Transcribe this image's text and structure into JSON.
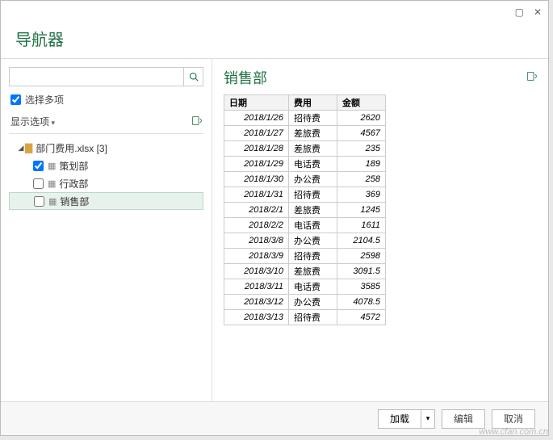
{
  "title": "导航器",
  "search": {
    "placeholder": ""
  },
  "selectMultiple": {
    "label": "选择多项",
    "checked": true
  },
  "displayOptions": {
    "label": "显示选项"
  },
  "tree": {
    "root": {
      "label": "部门费用.xlsx [3]"
    },
    "items": [
      {
        "label": "策划部",
        "checked": true,
        "selected": false
      },
      {
        "label": "行政部",
        "checked": false,
        "selected": false
      },
      {
        "label": "销售部",
        "checked": false,
        "selected": true
      }
    ]
  },
  "preview": {
    "title": "销售部",
    "columns": [
      "日期",
      "费用",
      "金额"
    ],
    "rows": [
      {
        "date": "2018/1/26",
        "type": "招待费",
        "amount": "2620"
      },
      {
        "date": "2018/1/27",
        "type": "差旅费",
        "amount": "4567"
      },
      {
        "date": "2018/1/28",
        "type": "差旅费",
        "amount": "235"
      },
      {
        "date": "2018/1/29",
        "type": "电话费",
        "amount": "189"
      },
      {
        "date": "2018/1/30",
        "type": "办公费",
        "amount": "258"
      },
      {
        "date": "2018/1/31",
        "type": "招待费",
        "amount": "369"
      },
      {
        "date": "2018/2/1",
        "type": "差旅费",
        "amount": "1245"
      },
      {
        "date": "2018/2/2",
        "type": "电话费",
        "amount": "1611"
      },
      {
        "date": "2018/3/8",
        "type": "办公费",
        "amount": "2104.5"
      },
      {
        "date": "2018/3/9",
        "type": "招待费",
        "amount": "2598"
      },
      {
        "date": "2018/3/10",
        "type": "差旅费",
        "amount": "3091.5"
      },
      {
        "date": "2018/3/11",
        "type": "电话费",
        "amount": "3585"
      },
      {
        "date": "2018/3/12",
        "type": "办公费",
        "amount": "4078.5"
      },
      {
        "date": "2018/3/13",
        "type": "招待费",
        "amount": "4572"
      }
    ]
  },
  "footer": {
    "load": "加载",
    "edit": "编辑",
    "cancel": "取消"
  },
  "watermark": "www.cfan.com.cn"
}
